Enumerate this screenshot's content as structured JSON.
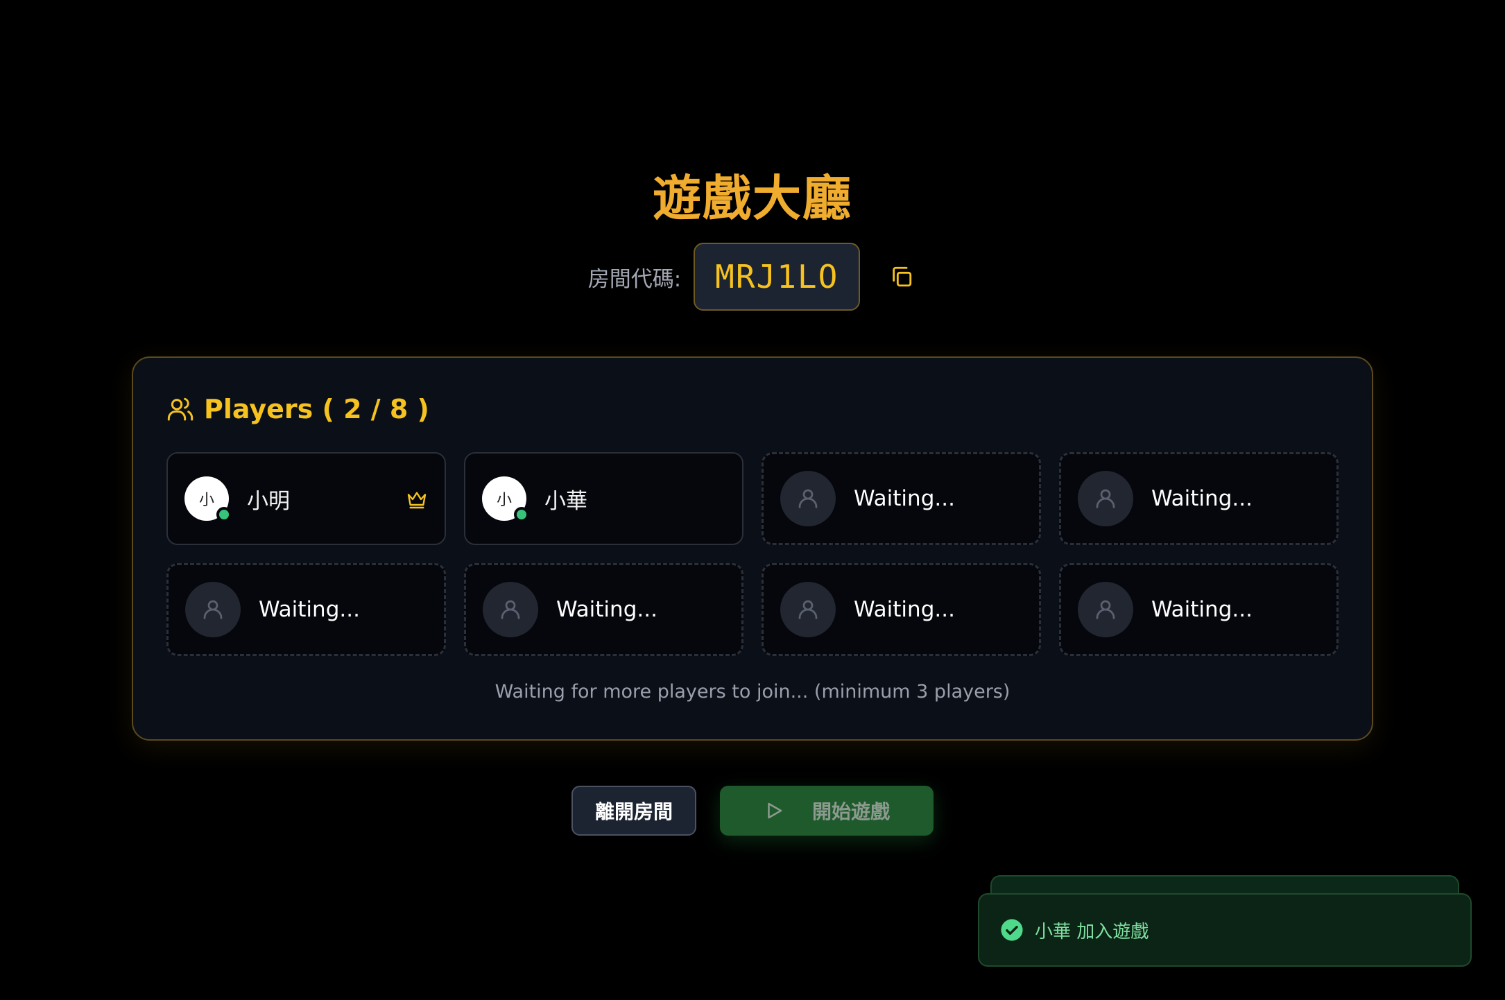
{
  "lobby": {
    "title": "遊戲大廳",
    "room_code_label": "房間代碼:",
    "room_code": "MRJ1LO"
  },
  "players_panel": {
    "title": "Players ( 2 / 8 )",
    "players": [
      {
        "avatar_text": "小",
        "name": "小明",
        "online": true,
        "host": true
      },
      {
        "avatar_text": "小",
        "name": "小華",
        "online": true,
        "host": false
      }
    ],
    "empty_slot_label": "Waiting...",
    "waiting_message": "Waiting for more players to join... (minimum 3 players)"
  },
  "actions": {
    "leave_label": "離開房間",
    "start_label": "開始遊戲"
  },
  "toast": {
    "message": "小華 加入遊戲"
  },
  "colors": {
    "accent_gold": "#f5c21f",
    "title_orange": "#f0ac2e",
    "online_green": "#37c47a",
    "start_green": "#1e5a2b"
  },
  "icons": {
    "copy": "copy-icon",
    "users": "users-icon",
    "crown": "crown-icon",
    "user_placeholder": "user-icon",
    "play": "play-icon",
    "check": "check-circle-icon"
  }
}
